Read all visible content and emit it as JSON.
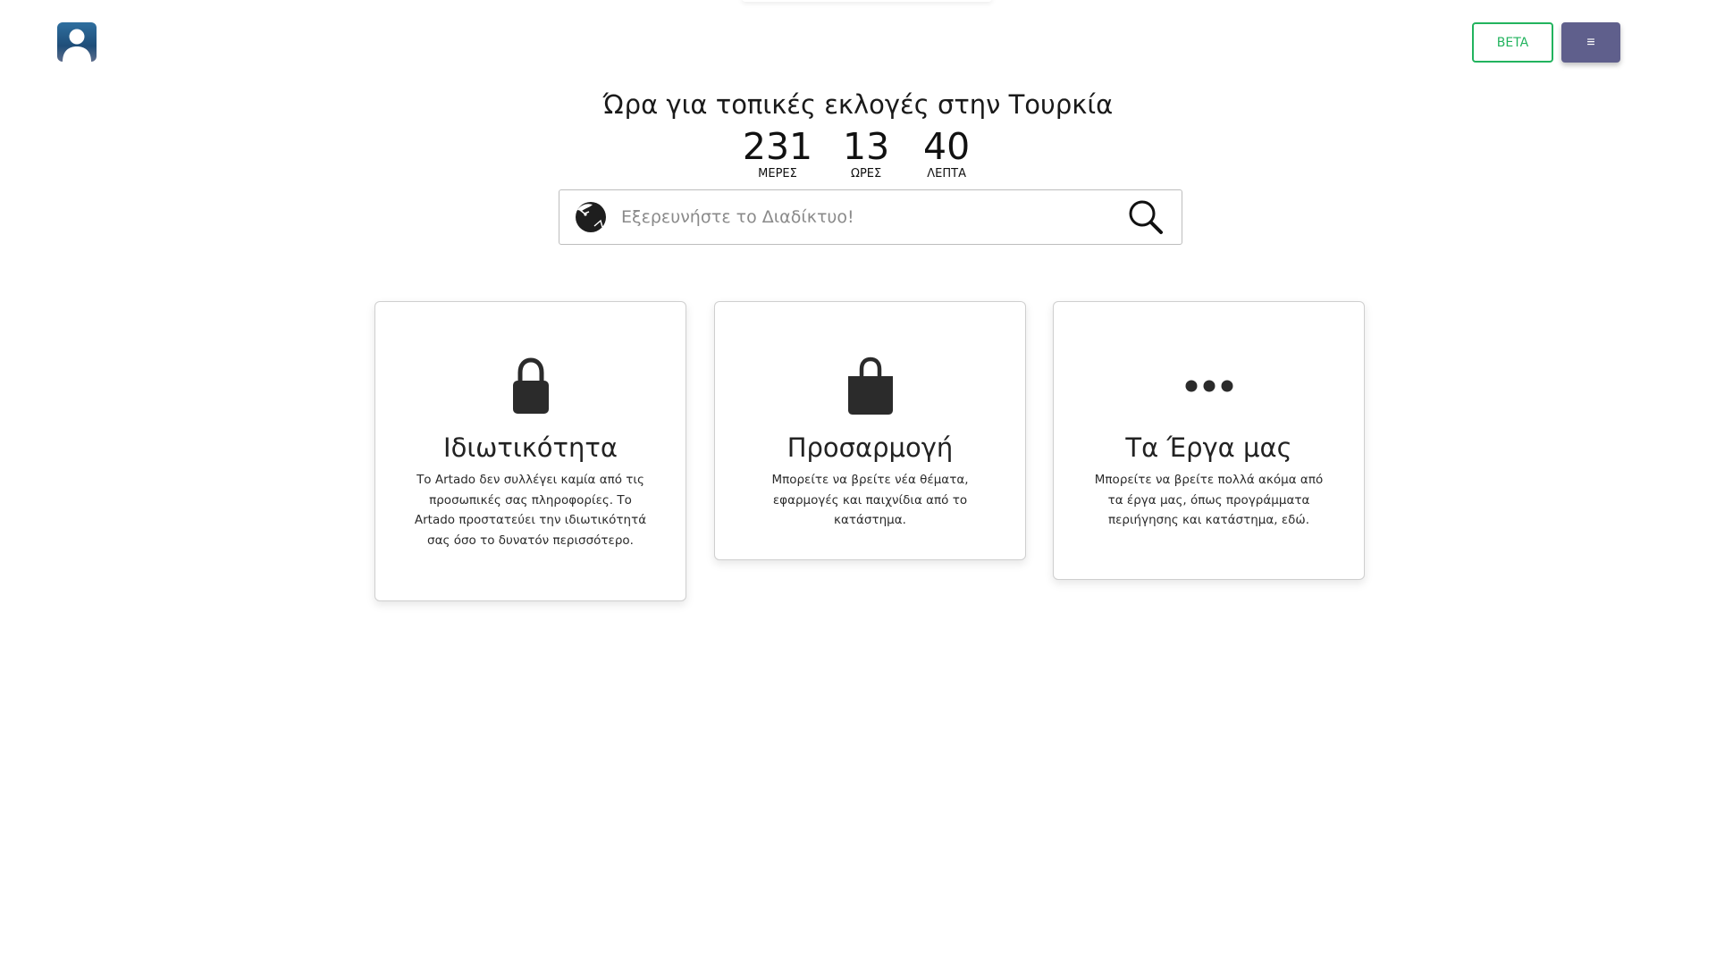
{
  "header": {
    "beta_label": "BETA",
    "menu_label": "≡"
  },
  "headline": "Ώρα για τοπικές εκλογές στην Τουρκία",
  "countdown": {
    "days": {
      "value": "231",
      "label": "ΜΕΡΕΣ"
    },
    "hours": {
      "value": "13",
      "label": "ΩΡΕΣ"
    },
    "minutes": {
      "value": "40",
      "label": "ΛΕΠΤΑ"
    }
  },
  "search": {
    "placeholder": "Εξερευνήστε το Διαδίκτυο!",
    "value": ""
  },
  "cards": [
    {
      "icon": "lock-icon",
      "title": "Ιδιωτικότητα",
      "text": "Το Artado δεν συλλέγει καμία από τις προσωπικές σας πληροφορίες. Το Artado προστατεύει την ιδιωτικότητά σας όσο το δυνατόν περισσότερο."
    },
    {
      "icon": "shopping-bag-icon",
      "title": "Προσαρμογή",
      "text": "Μπορείτε να βρείτε νέα θέματα, εφαρμογές και παιχνίδια από το κατάστημα."
    },
    {
      "icon": "more-dots-icon",
      "title": "Τα Έργα μας",
      "text": "Μπορείτε να βρείτε πολλά ακόμα από τα έργα μας, όπως προγράμματα περιήγησης και κατάστημα, εδώ."
    }
  ],
  "colors": {
    "beta_green": "#22b35e",
    "menu_purple": "#5f5f8c",
    "icon_dark": "#2b2b2b"
  }
}
